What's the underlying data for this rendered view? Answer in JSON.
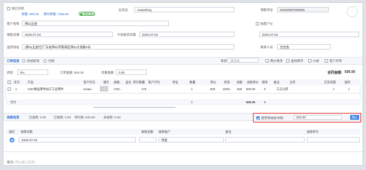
{
  "header": {
    "checkbox_label": "预订开单",
    "balance_label": "余额: 500.00",
    "prepay_label": "预付余额: 7460.00",
    "badge_label": "审核通过",
    "salesman_label": "业务员",
    "salesman_value": "mxiaofeng",
    "order_no_label": "销售单号",
    "order_no_value": "XS202507030005"
  },
  "form": {
    "customer_label": "客户名称",
    "customer_value": "佛山五金",
    "customer_price_label": "按客户价",
    "order_date_label": "销售日期",
    "order_date_value": "2025-07-03",
    "plan_date_label": "计划发货日期",
    "plan_date_value": "2025-07-03",
    "unknown_date_value": "2025-07-03",
    "address_label": "送货地址",
    "address_value": "(佛山五金行)广东省佛山市南海区佛山大道路2号",
    "contact_label": "联系人员",
    "contact_value": "合合鱼"
  },
  "order_info": {
    "title": "订单信息",
    "radio1": "添加新增",
    "radio2": "付款",
    "source_label": "来源",
    "source_value": "请选择",
    "check1": "费价格改",
    "check2": "查找库存",
    "check3": "价格",
    "check4": "客户开单",
    "discount_label": "折扣",
    "discount_value": "0%",
    "order_amount_label": "订单金额: 500.00",
    "reduce_label": "优惠金额",
    "reduce_value": "0.00",
    "total_label": "合同金额:",
    "total_value": "500.00"
  },
  "table": {
    "headers": [
      "序号",
      "产品",
      "客户料号",
      "图片",
      "规格..",
      "品名",
      "库存数量",
      "客户代号",
      "单位",
      "数量",
      "单价",
      "折扣",
      "金额",
      "含税单价",
      "税率",
      "备注",
      "仓库",
      "交货日期",
      "操作"
    ],
    "row": [
      "1",
      "CNC精品零件加工工业零件",
      "mxiao..",
      "",
      "CNC...",
      "",
      "175",
      "",
      "",
      "1",
      "500",
      "100%",
      "500",
      "500.00",
      "0",
      "",
      "三方仓库",
      "",
      ""
    ],
    "extra_cells": [
      "1",
      "1"
    ],
    "sum_label": "合计",
    "sum_qty": "1",
    "sum_amount": "500.00",
    "sum_tax": "0"
  },
  "receipt": {
    "title": "收款信息",
    "received_label": "已收款: 0.00",
    "paid_label": "已收款: 0.00",
    "pending_label": "待付款: 500.00",
    "unpaid_label": "未收款: 0.00",
    "prepay_check_label": "使用预收款冲销:",
    "prepay_value": "500.00",
    "confirm_btn": "确认",
    "headers": [
      "操作",
      "收款日期",
      "收款金额",
      "收款账户",
      "备注",
      "收款单号"
    ],
    "row_date": "2025-07-03",
    "row_account": "现金"
  },
  "footer": {
    "note_label": "备注:",
    "note_placeholder": "(可以录入信息)"
  }
}
